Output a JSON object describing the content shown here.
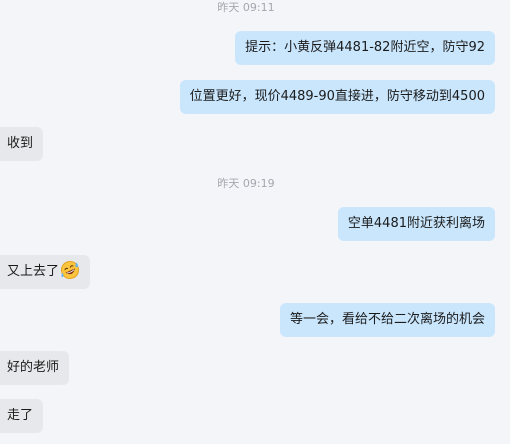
{
  "conversation": {
    "timestamps": [
      "昨天 09:11",
      "昨天 09:19"
    ],
    "messages": [
      {
        "side": "out",
        "text": "提示：小黄反弹4481-82附近空，防守92"
      },
      {
        "side": "out",
        "text": "位置更好，现价4489-90直接进，防守移动到4500"
      },
      {
        "side": "in",
        "text": "收到"
      },
      {
        "side": "out",
        "text": "空单4481附近获利离场"
      },
      {
        "side": "in",
        "text": "又上去了",
        "emoji": "grinning-sweat-emoji"
      },
      {
        "side": "out",
        "text": "等一会，看给不给二次离场的机会"
      },
      {
        "side": "in",
        "text": "好的老师"
      },
      {
        "side": "in",
        "text": "走了"
      }
    ]
  },
  "colors": {
    "background": "#f3f5f9",
    "outgoing_bubble": "#c9e6fd",
    "incoming_bubble": "#e7e8eb",
    "timestamp_text": "#a3a7ad"
  }
}
